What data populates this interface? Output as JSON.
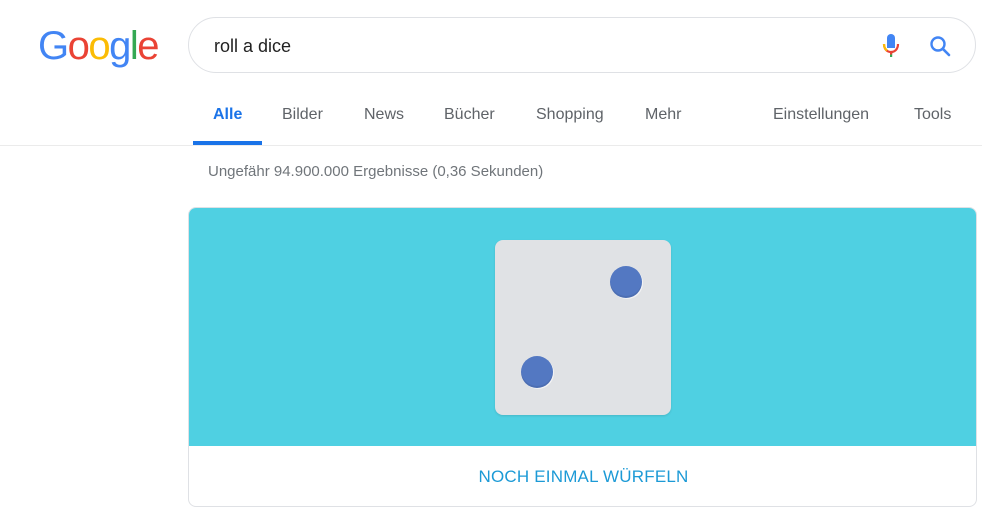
{
  "logo": {
    "letters": [
      {
        "char": "G",
        "color": "#4285f4"
      },
      {
        "char": "o",
        "color": "#ea4335"
      },
      {
        "char": "o",
        "color": "#fbbc05"
      },
      {
        "char": "g",
        "color": "#4285f4"
      },
      {
        "char": "l",
        "color": "#34a853"
      },
      {
        "char": "e",
        "color": "#ea4335"
      }
    ]
  },
  "search": {
    "query": "roll a dice",
    "mic_icon": "mic-icon",
    "search_icon": "search-icon"
  },
  "tabs": [
    {
      "label": "Alle",
      "active": true
    },
    {
      "label": "Bilder",
      "active": false
    },
    {
      "label": "News",
      "active": false
    },
    {
      "label": "Bücher",
      "active": false
    },
    {
      "label": "Shopping",
      "active": false
    },
    {
      "label": "Mehr",
      "active": false
    }
  ],
  "tools": {
    "settings_label": "Einstellungen",
    "tools_label": "Tools"
  },
  "result_stats": "Ungefähr 94.900.000 Ergebnisse (0,36 Sekunden)",
  "dice_card": {
    "die_value": 2,
    "background_color": "#4fd0e2",
    "pip_color": "#5378c2",
    "roll_again_label": "NOCH EINMAL WÜRFELN"
  }
}
